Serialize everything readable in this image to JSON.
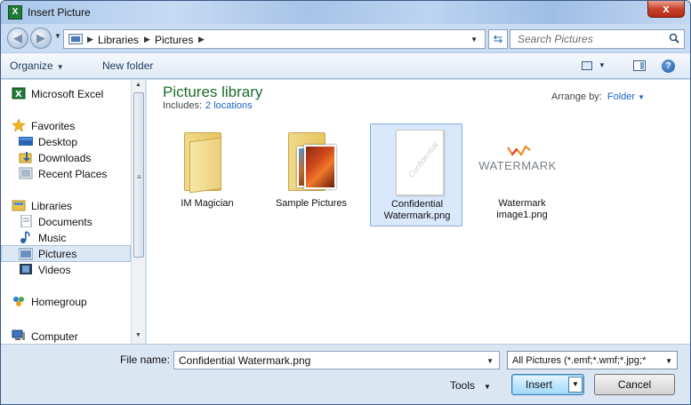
{
  "window": {
    "title": "Insert Picture",
    "close_glyph": "x"
  },
  "address": {
    "crumbs": [
      "Libraries",
      "Pictures"
    ],
    "search_placeholder": "Search Pictures"
  },
  "toolbar": {
    "organize_label": "Organize",
    "new_folder_label": "New folder"
  },
  "nav": {
    "items": [
      {
        "label": "Microsoft Excel",
        "icon": "excel-icon"
      },
      {
        "label": "Favorites",
        "icon": "star-icon"
      },
      {
        "label": "Desktop",
        "icon": "desktop-icon"
      },
      {
        "label": "Downloads",
        "icon": "downloads-icon"
      },
      {
        "label": "Recent Places",
        "icon": "recent-places-icon"
      },
      {
        "label": "Libraries",
        "icon": "libraries-icon"
      },
      {
        "label": "Documents",
        "icon": "documents-icon"
      },
      {
        "label": "Music",
        "icon": "music-icon"
      },
      {
        "label": "Pictures",
        "icon": "pictures-icon"
      },
      {
        "label": "Videos",
        "icon": "videos-icon"
      },
      {
        "label": "Homegroup",
        "icon": "homegroup-icon"
      },
      {
        "label": "Computer",
        "icon": "computer-icon"
      }
    ],
    "selected": "Pictures"
  },
  "library": {
    "title": "Pictures library",
    "includes_label": "Includes:",
    "includes_link": "2 locations",
    "arrange_label": "Arrange by:",
    "arrange_value": "Folder"
  },
  "files": [
    {
      "line1": "IM Magician",
      "line2": "",
      "kind": "folder"
    },
    {
      "line1": "Sample Pictures",
      "line2": "",
      "kind": "folder-photos"
    },
    {
      "line1": "Confidential",
      "line2": "Watermark.png",
      "kind": "image",
      "thumb_text": "Confidential",
      "selected": true
    },
    {
      "line1": "Watermark",
      "line2": "image1.png",
      "kind": "image",
      "thumb_text": "WATERMARK"
    }
  ],
  "bottom": {
    "file_name_label": "File name:",
    "file_name_value": "Confidential Watermark.png",
    "filter_value": "All Pictures (*.emf;*.wmf;*.jpg;*",
    "tools_label": "Tools",
    "insert_label": "Insert",
    "cancel_label": "Cancel"
  },
  "colors": {
    "library_title": "#1e6b2a",
    "link": "#1b64c4",
    "selection": "#d9e8fb",
    "chrome": "#c9dcf2"
  }
}
